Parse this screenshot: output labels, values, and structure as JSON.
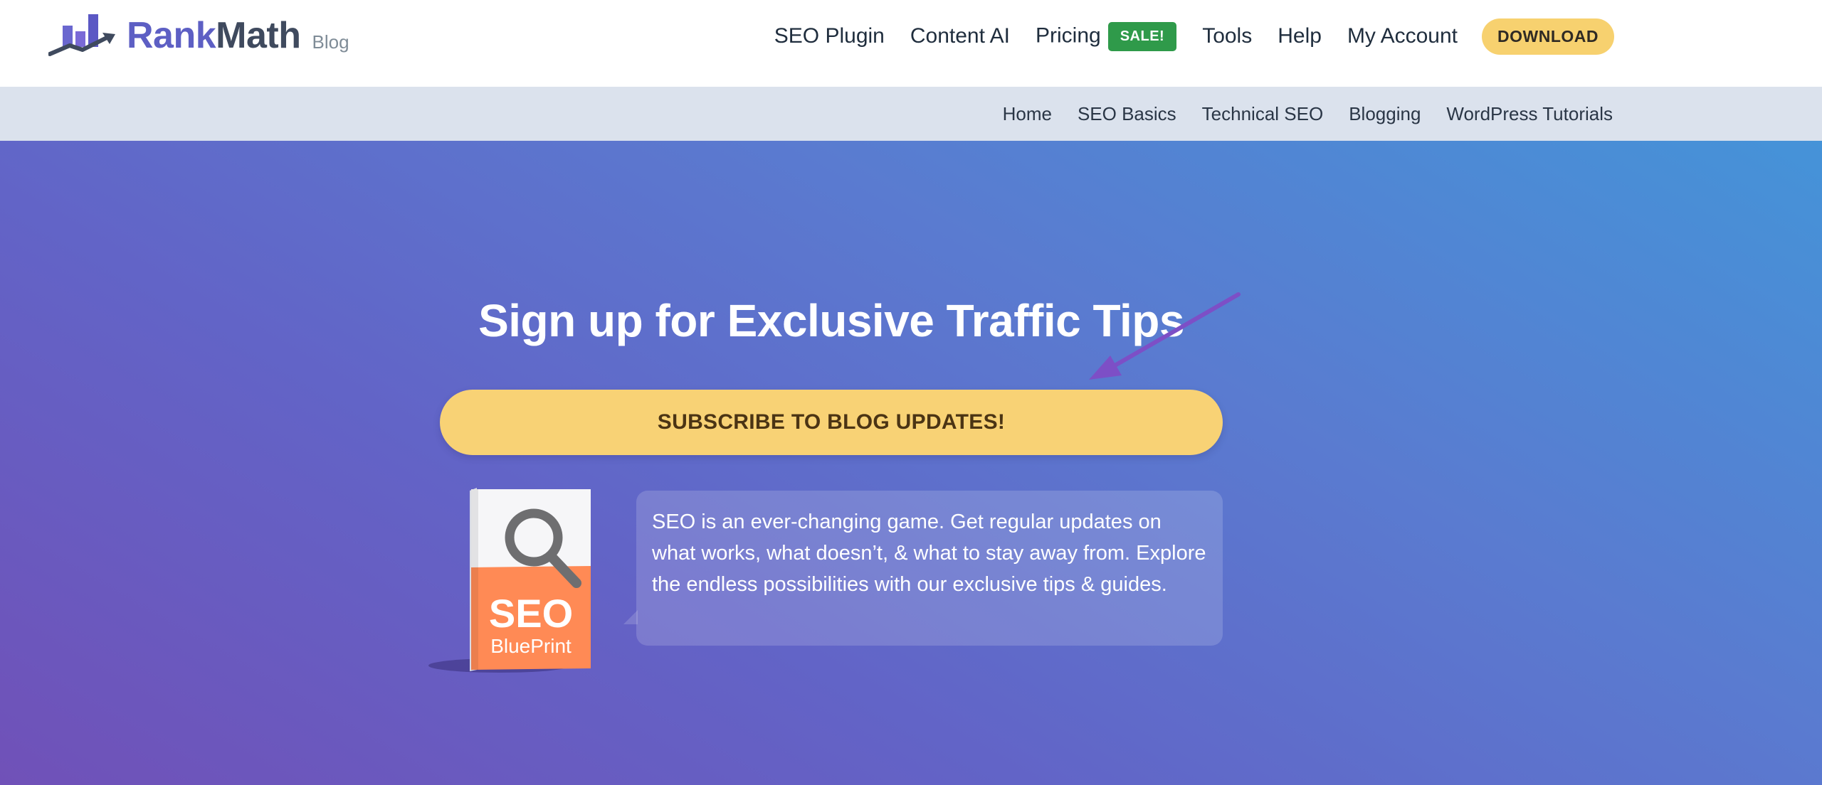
{
  "brand": {
    "name_part1": "Rank",
    "name_part2": "Math",
    "section": "Blog"
  },
  "main_nav": {
    "items": [
      "SEO Plugin",
      "Content AI",
      "Pricing",
      "Tools",
      "Help",
      "My Account"
    ],
    "sale_badge": "SALE!",
    "download_label": "DOWNLOAD"
  },
  "sub_nav": {
    "items": [
      "Home",
      "SEO Basics",
      "Technical SEO",
      "Blogging",
      "WordPress Tutorials"
    ]
  },
  "hero": {
    "title": "Sign up for Exclusive Traffic Tips",
    "subscribe_label": "SUBSCRIBE TO BLOG UPDATES!",
    "description": "SEO is an ever-changing game. Get regular updates on what works, what doesn’t, & what to stay away from. Explore the endless possibilities with our exclusive tips & guides.",
    "book_title": "SEO",
    "book_subtitle": "BluePrint"
  },
  "colors": {
    "brand_purple": "#5d5fc4",
    "download_yellow": "#f7d16f",
    "sale_green": "#2f9a4a",
    "subnav_bg": "#dbe2ed",
    "hero_gradient_start": "#7051b8",
    "hero_gradient_end": "#4593d8",
    "book_orange": "#ff8a55"
  },
  "icons": {
    "logo": "rankmath-bar-chart-logo",
    "arrow": "pointer-arrow-icon",
    "book_magnifier": "magnifier-icon"
  }
}
